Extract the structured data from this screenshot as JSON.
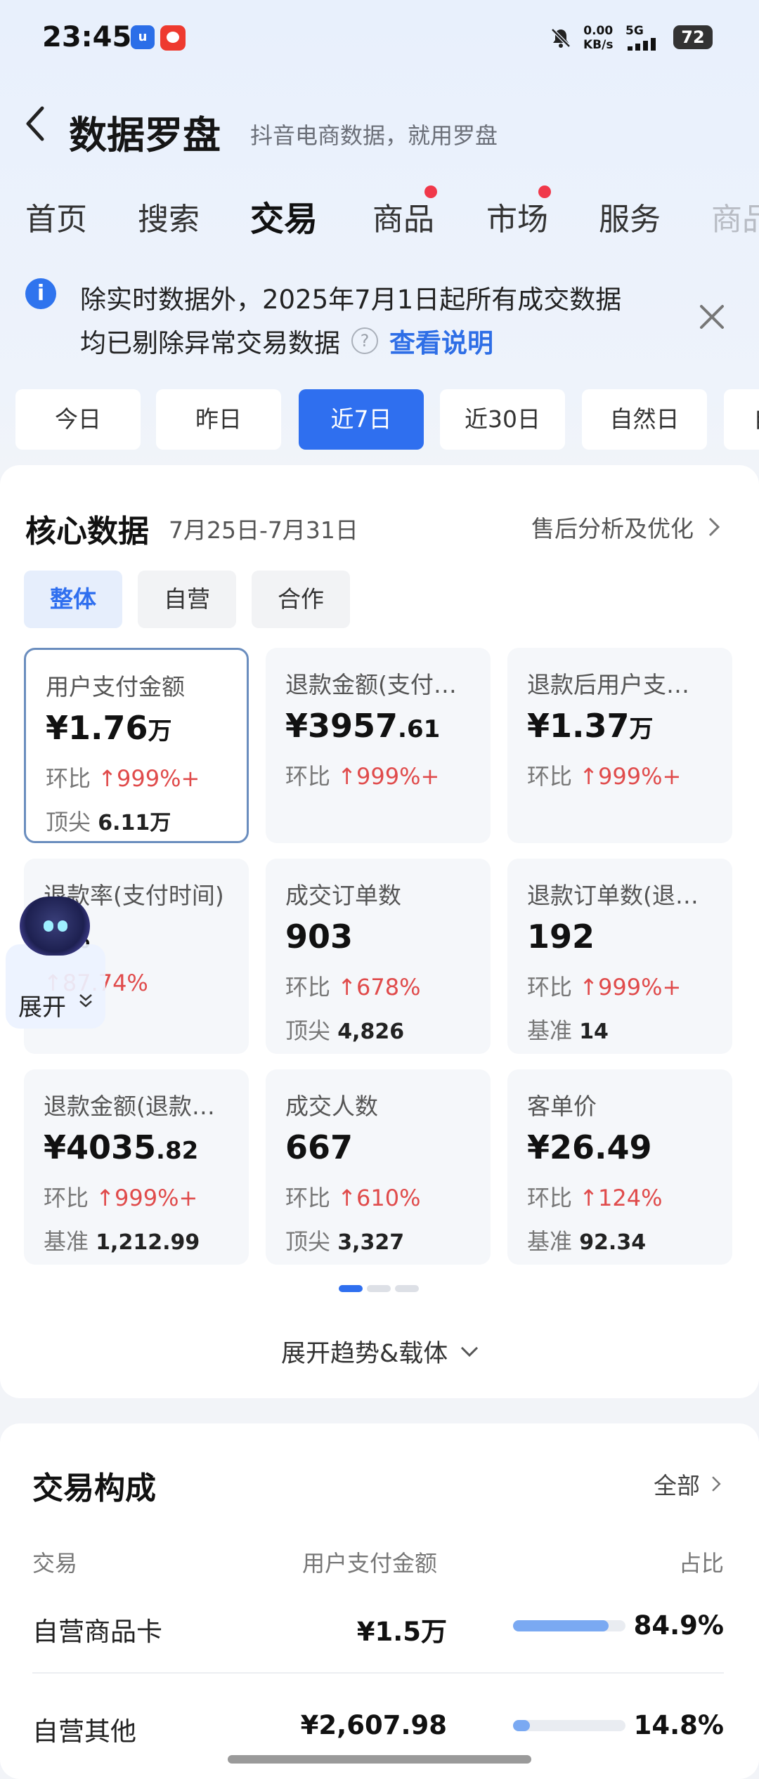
{
  "status": {
    "time": "23:45",
    "speed_value": "0.00",
    "speed_unit": "KB/s",
    "network": "5G",
    "battery": "72"
  },
  "header": {
    "title": "数据罗盘",
    "subtitle": "抖音电商数据，就用罗盘"
  },
  "tabs": [
    {
      "label": "首页"
    },
    {
      "label": "搜索"
    },
    {
      "label": "交易"
    },
    {
      "label": "商品"
    },
    {
      "label": "市场"
    },
    {
      "label": "服务"
    },
    {
      "label": "商品"
    }
  ],
  "notice": {
    "line1": "除实时数据外，2025年7月1日起所有成交数据",
    "line2": "均已剔除异常交易数据",
    "link": "查看说明"
  },
  "date_filters": [
    "今日",
    "昨日",
    "近7日",
    "近30日",
    "自然日",
    "自"
  ],
  "core": {
    "title": "核心数据",
    "range": "7月25日-7月31日",
    "link": "售后分析及优化",
    "segments": [
      "整体",
      "自营",
      "合作"
    ],
    "expand": "展开趋势&载体"
  },
  "metrics": [
    {
      "label": "用户支付金额",
      "value": "¥1.76",
      "unit": "万",
      "comp_label": "环比",
      "comp": "999%+",
      "bench_label": "顶尖",
      "bench": "6.11万"
    },
    {
      "label": "退款金额(支付…",
      "value": "¥3957",
      "unit": ".61",
      "comp_label": "环比",
      "comp": "999%+",
      "bench_label": "",
      "bench": ""
    },
    {
      "label": "退款后用户支…",
      "value": "¥1.37",
      "unit": "万",
      "comp_label": "环比",
      "comp": "999%+",
      "bench_label": "",
      "bench": ""
    },
    {
      "label": "退款率(支付时间)",
      "value": "4",
      "unit": "%",
      "comp_label": "",
      "comp": "87.74%",
      "bench_label": "",
      "bench": ""
    },
    {
      "label": "成交订单数",
      "value": "903",
      "unit": "",
      "comp_label": "环比",
      "comp": "678%",
      "bench_label": "顶尖",
      "bench": "4,826"
    },
    {
      "label": "退款订单数(退…",
      "value": "192",
      "unit": "",
      "comp_label": "环比",
      "comp": "999%+",
      "bench_label": "基准",
      "bench": "14"
    },
    {
      "label": "退款金额(退款…",
      "value": "¥4035",
      "unit": ".82",
      "comp_label": "环比",
      "comp": "999%+",
      "bench_label": "基准",
      "bench": "1,212.99"
    },
    {
      "label": "成交人数",
      "value": "667",
      "unit": "",
      "comp_label": "环比",
      "comp": "610%",
      "bench_label": "顶尖",
      "bench": "3,327"
    },
    {
      "label": "客单价",
      "value": "¥26.49",
      "unit": "",
      "comp_label": "环比",
      "comp": "124%",
      "bench_label": "基准",
      "bench": "92.34"
    }
  ],
  "assistant": {
    "label": "展开"
  },
  "composition": {
    "title": "交易构成",
    "all": "全部",
    "headers": [
      "交易",
      "用户支付金额",
      "占比"
    ],
    "rows": [
      {
        "name": "自营商品卡",
        "amount": "¥1.5万",
        "pct": "84.9%",
        "share": 0.849
      },
      {
        "name": "自营其他",
        "amount": "¥2,607.98",
        "pct": "14.8%",
        "share": 0.148
      }
    ]
  },
  "colors": {
    "accent": "#2f6fef",
    "up": "#e04b4b",
    "dot": "#f0384a"
  }
}
